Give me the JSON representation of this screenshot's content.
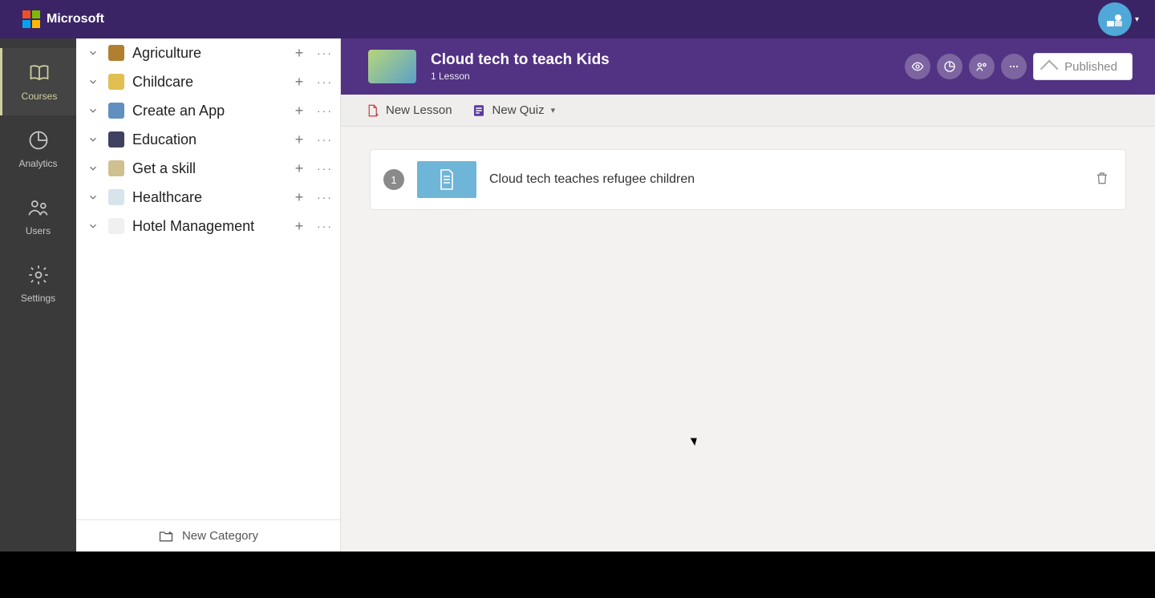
{
  "brand": "Microsoft",
  "leftnav": {
    "items": [
      {
        "label": "Courses"
      },
      {
        "label": "Analytics"
      },
      {
        "label": "Users"
      },
      {
        "label": "Settings"
      }
    ]
  },
  "categories": {
    "items": [
      {
        "name": "Agriculture",
        "thumb": "#b08030"
      },
      {
        "name": "Childcare",
        "thumb": "#e0c050"
      },
      {
        "name": "Create an App",
        "thumb": "#6090c0"
      },
      {
        "name": "Education",
        "thumb": "#404060"
      },
      {
        "name": "Get a skill",
        "thumb": "#d0c090"
      },
      {
        "name": "Healthcare",
        "thumb": "#d8e4ec"
      },
      {
        "name": "Hotel Management",
        "thumb": "#f0f0f0"
      }
    ],
    "new_label": "New Category"
  },
  "course": {
    "title": "Cloud tech to teach Kids",
    "subtitle": "1 Lesson",
    "publish_label": "Published"
  },
  "toolbar": {
    "new_lesson": "New Lesson",
    "new_quiz": "New Quiz"
  },
  "lessons": {
    "items": [
      {
        "num": "1",
        "title": "Cloud tech teaches refugee children"
      }
    ]
  }
}
